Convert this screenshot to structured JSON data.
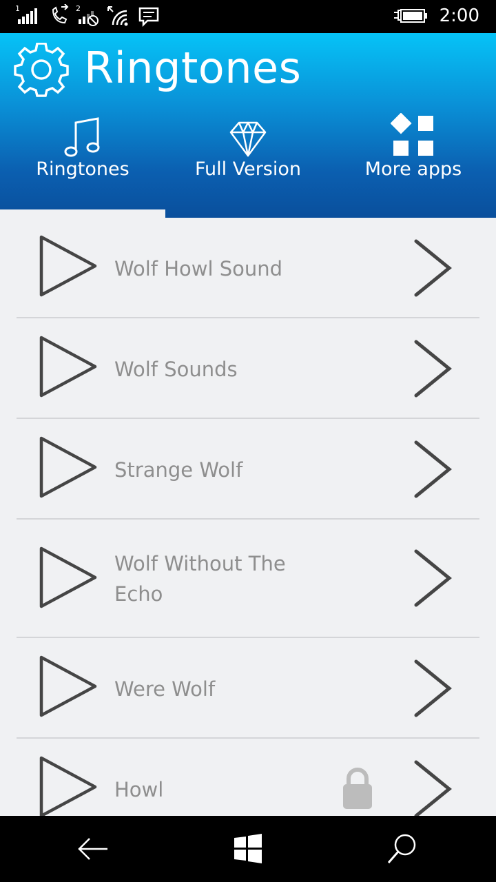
{
  "status_bar": {
    "sim1_label": "1",
    "sim2_label": "2",
    "time": "2:00",
    "icons": [
      "signal-sim1-icon",
      "call-forwarding-icon",
      "signal-sim2-no-data-icon",
      "wifi-icon",
      "message-icon",
      "battery-charging-icon"
    ]
  },
  "header": {
    "title": "Ringtones",
    "settings_icon": "gear-icon",
    "colors": {
      "gradient_top": "#06c3f7",
      "gradient_bottom": "#0a4f9c"
    }
  },
  "tabs": [
    {
      "label": "Ringtones",
      "icon": "music-note-icon",
      "selected": true
    },
    {
      "label": "Full Version",
      "icon": "diamond-icon",
      "selected": false
    },
    {
      "label": "More apps",
      "icon": "apps-grid-icon",
      "selected": false
    }
  ],
  "ringtones": [
    {
      "name": "Wolf Howl Sound",
      "locked": false
    },
    {
      "name": "Wolf Sounds",
      "locked": false
    },
    {
      "name": "Strange Wolf",
      "locked": false
    },
    {
      "name": "Wolf Without The Echo",
      "locked": false
    },
    {
      "name": "Were Wolf",
      "locked": false
    },
    {
      "name": "Howl",
      "locked": true
    }
  ],
  "nav_bar": {
    "buttons": [
      "back-icon",
      "windows-start-icon",
      "search-icon"
    ]
  }
}
